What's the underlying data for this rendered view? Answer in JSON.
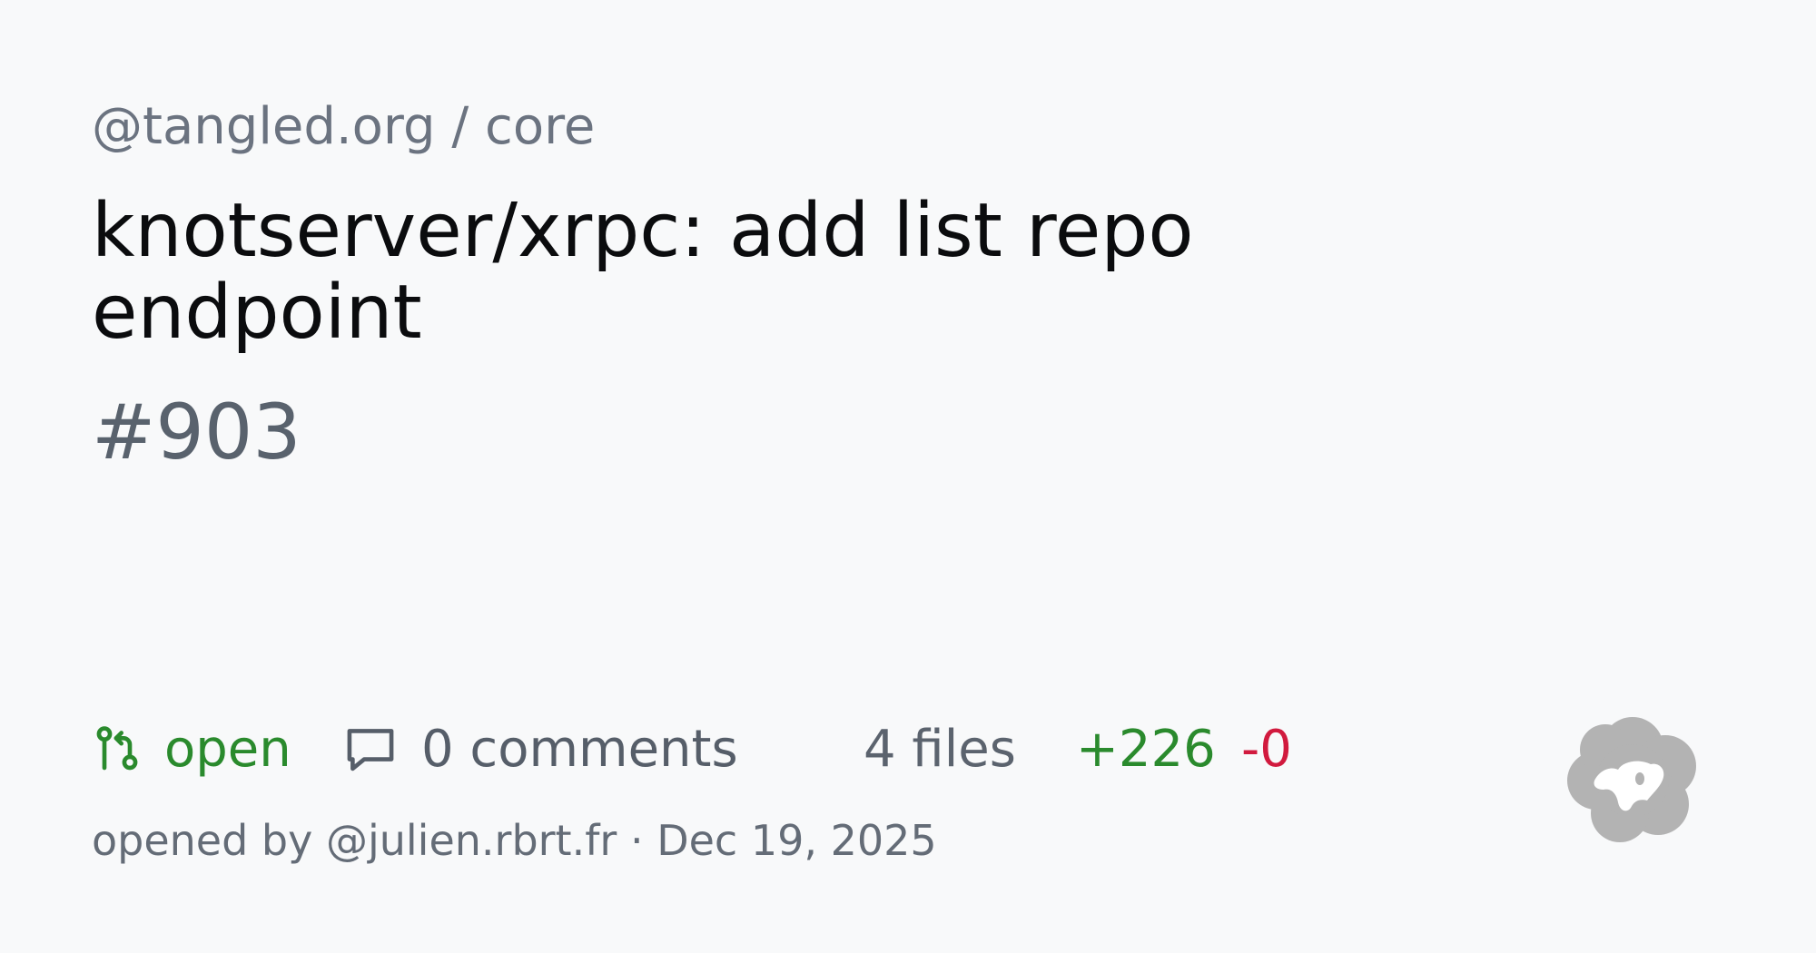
{
  "repo": {
    "owner": "@tangled.org",
    "separator": "/",
    "name": "core"
  },
  "pull_request": {
    "title": "knotserver/xrpc: add list repo endpoint",
    "number": "#903",
    "status": "open",
    "comments": "0 comments",
    "files": "4 files",
    "additions": "+226",
    "deletions": "-0",
    "opened_by": "opened by @julien.rbrt.fr · Dec 19, 2025"
  },
  "icons": {
    "status": "git-pull-request-icon",
    "comments": "comment-icon",
    "logo": "tangled-logo-icon"
  },
  "colors": {
    "background": "#f8f9fa",
    "open_green": "#2a8a2d",
    "deletions_red": "#d11a3e",
    "muted": "#6b7380",
    "logo_gray": "#b3b3b3"
  }
}
